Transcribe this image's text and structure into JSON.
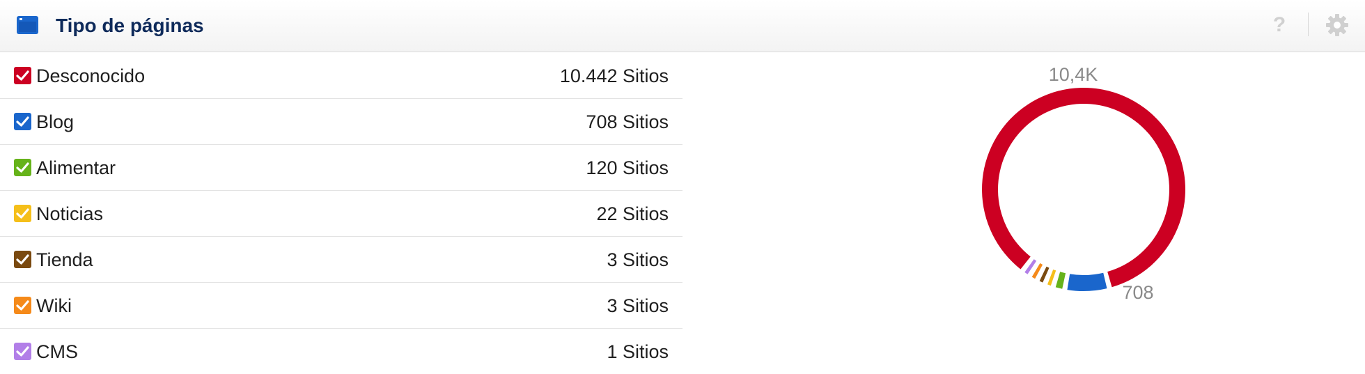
{
  "header": {
    "title": "Tipo de páginas",
    "window_icon": "browser-window-icon",
    "help_icon": "question-icon",
    "help_glyph": "?",
    "settings_icon": "gear-icon"
  },
  "colors": {
    "title": "#0e2a5a",
    "Desconocido": "#cc0022",
    "Blog": "#1a66cc",
    "Alimentar": "#66b31a",
    "Noticias": "#f5bf1a",
    "Tienda": "#7a4a10",
    "Wiki": "#f58a1a",
    "CMS": "#b27fe8"
  },
  "items": [
    {
      "label": "Desconocido",
      "value": "10.442 Sitios",
      "color": "#cc0022",
      "checked": true
    },
    {
      "label": "Blog",
      "value": "708 Sitios",
      "color": "#1a66cc",
      "checked": true
    },
    {
      "label": "Alimentar",
      "value": "120 Sitios",
      "color": "#66b31a",
      "checked": true
    },
    {
      "label": "Noticias",
      "value": "22 Sitios",
      "color": "#f5bf1a",
      "checked": true
    },
    {
      "label": "Tienda",
      "value": "3 Sitios",
      "color": "#7a4a10",
      "checked": true
    },
    {
      "label": "Wiki",
      "value": "3 Sitios",
      "color": "#f58a1a",
      "checked": true
    },
    {
      "label": "CMS",
      "value": "1 Sitios",
      "color": "#b27fe8",
      "checked": true
    }
  ],
  "chart_data": {
    "type": "pie",
    "variant": "donut",
    "categories": [
      "Desconocido",
      "Blog",
      "Alimentar",
      "Noticias",
      "Tienda",
      "Wiki",
      "CMS"
    ],
    "values": [
      10442,
      708,
      120,
      22,
      3,
      3,
      1
    ],
    "data_labels": [
      {
        "category": "Desconocido",
        "text": "10,4K"
      },
      {
        "category": "Blog",
        "text": "708"
      }
    ],
    "legend": "left-list"
  }
}
